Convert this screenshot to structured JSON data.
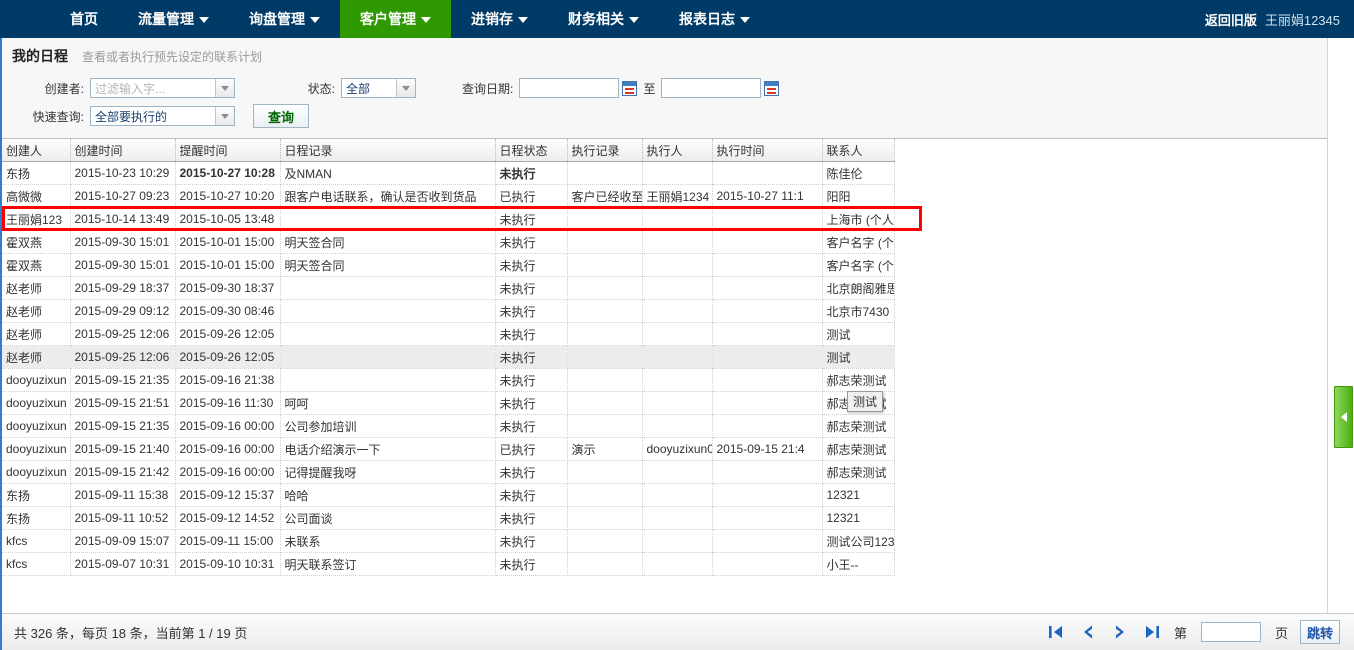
{
  "nav": {
    "items": [
      {
        "label": "首页",
        "has_caret": false,
        "active": false
      },
      {
        "label": "流量管理",
        "has_caret": true,
        "active": false
      },
      {
        "label": "询盘管理",
        "has_caret": true,
        "active": false
      },
      {
        "label": "客户管理",
        "has_caret": true,
        "active": true
      },
      {
        "label": "进销存",
        "has_caret": true,
        "active": false
      },
      {
        "label": "财务相关",
        "has_caret": true,
        "active": false
      },
      {
        "label": "报表日志",
        "has_caret": true,
        "active": false
      }
    ],
    "old_version": "返回旧版",
    "user": "王丽娟12345"
  },
  "header": {
    "title": "我的日程",
    "subtitle": "查看或者执行预先设定的联系计划"
  },
  "filters": {
    "creator_label": "创建者:",
    "creator_placeholder": "过滤输入字...",
    "creator_value": "",
    "status_label": "状态:",
    "status_value": "全部",
    "date_label": "查询日期:",
    "date_from": "",
    "date_to": "",
    "date_sep": "至",
    "quick_label": "快速查询:",
    "quick_value": "全部要执行的",
    "query_button": "查询"
  },
  "table": {
    "columns": [
      "创建人",
      "创建时间",
      "提醒时间",
      "日程记录",
      "日程状态",
      "执行记录",
      "执行人",
      "执行时间",
      "联系人"
    ],
    "rows": [
      {
        "creator": "东扬",
        "created": "2015-10-23 10:29",
        "remind": "2015-10-27 10:28",
        "note": "及NMAN",
        "status": "未执行",
        "exec_note": "",
        "exec_by": "",
        "exec_time": "",
        "contact": "陈佳伦",
        "remind_style": "blue-bold",
        "status_style": "blue-bold",
        "highlight": false,
        "alt": false
      },
      {
        "creator": "高微微",
        "created": "2015-10-27 09:23",
        "remind": "2015-10-27 10:20",
        "note": "跟客户电话联系，确认是否收到货品",
        "status": "已执行",
        "exec_note": "客户已经收至",
        "exec_by": "王丽娟1234",
        "exec_time": "2015-10-27 11:1",
        "contact": "阳阳",
        "remind_style": "green",
        "status_style": "green",
        "highlight": true,
        "alt": false
      },
      {
        "creator": "王丽娟123",
        "created": "2015-10-14 13:49",
        "remind": "2015-10-05 13:48",
        "note": "",
        "status": "未执行",
        "exec_note": "",
        "exec_by": "",
        "exec_time": "",
        "contact": "上海市 (个人",
        "remind_style": "red",
        "status_style": "red",
        "highlight": false,
        "alt": false
      },
      {
        "creator": "霍双燕",
        "created": "2015-09-30 15:01",
        "remind": "2015-10-01 15:00",
        "note": "明天签合同",
        "status": "未执行",
        "exec_note": "",
        "exec_by": "",
        "exec_time": "",
        "contact": "客户名字 (个",
        "remind_style": "red",
        "status_style": "red",
        "highlight": false,
        "alt": false
      },
      {
        "creator": "霍双燕",
        "created": "2015-09-30 15:01",
        "remind": "2015-10-01 15:00",
        "note": "明天签合同",
        "status": "未执行",
        "exec_note": "",
        "exec_by": "",
        "exec_time": "",
        "contact": "客户名字 (个",
        "remind_style": "red",
        "status_style": "red",
        "highlight": false,
        "alt": false
      },
      {
        "creator": "赵老师",
        "created": "2015-09-29 18:37",
        "remind": "2015-09-30 18:37",
        "note": "",
        "status": "未执行",
        "exec_note": "",
        "exec_by": "",
        "exec_time": "",
        "contact": "北京朗阁雅思",
        "remind_style": "red",
        "status_style": "red",
        "highlight": false,
        "alt": false
      },
      {
        "creator": "赵老师",
        "created": "2015-09-29 09:12",
        "remind": "2015-09-30 08:46",
        "note": "",
        "status": "未执行",
        "exec_note": "",
        "exec_by": "",
        "exec_time": "",
        "contact": "北京市7430",
        "remind_style": "red",
        "status_style": "red",
        "highlight": false,
        "alt": false
      },
      {
        "creator": "赵老师",
        "created": "2015-09-25 12:06",
        "remind": "2015-09-26 12:05",
        "note": "",
        "status": "未执行",
        "exec_note": "",
        "exec_by": "",
        "exec_time": "",
        "contact": "测试",
        "remind_style": "red",
        "status_style": "red",
        "highlight": false,
        "alt": false
      },
      {
        "creator": "赵老师",
        "created": "2015-09-25 12:06",
        "remind": "2015-09-26 12:05",
        "note": "",
        "status": "未执行",
        "exec_note": "",
        "exec_by": "",
        "exec_time": "",
        "contact": "测试",
        "remind_style": "red",
        "status_style": "red",
        "highlight": false,
        "alt": true
      },
      {
        "creator": "dooyuzixun",
        "created": "2015-09-15 21:35",
        "remind": "2015-09-16 21:38",
        "note": "",
        "status": "未执行",
        "exec_note": "",
        "exec_by": "",
        "exec_time": "",
        "contact": "郝志荣测试",
        "remind_style": "red",
        "status_style": "red",
        "highlight": false,
        "alt": false
      },
      {
        "creator": "dooyuzixun",
        "created": "2015-09-15 21:51",
        "remind": "2015-09-16 11:30",
        "note": "呵呵",
        "status": "未执行",
        "exec_note": "",
        "exec_by": "",
        "exec_time": "",
        "contact": "郝志荣测试",
        "remind_style": "red",
        "status_style": "red",
        "highlight": false,
        "alt": false
      },
      {
        "creator": "dooyuzixun",
        "created": "2015-09-15 21:35",
        "remind": "2015-09-16 00:00",
        "note": "公司参加培训",
        "status": "未执行",
        "exec_note": "",
        "exec_by": "",
        "exec_time": "",
        "contact": "郝志荣测试",
        "remind_style": "red",
        "status_style": "red",
        "highlight": false,
        "alt": false
      },
      {
        "creator": "dooyuzixun",
        "created": "2015-09-15 21:40",
        "remind": "2015-09-16 00:00",
        "note": "电话介绍演示一下",
        "status": "已执行",
        "exec_note": "演示",
        "exec_by": "dooyuzixun0",
        "exec_time": "2015-09-15 21:4",
        "contact": "郝志荣测试",
        "remind_style": "green",
        "status_style": "green",
        "highlight": false,
        "alt": false
      },
      {
        "creator": "dooyuzixun",
        "created": "2015-09-15 21:42",
        "remind": "2015-09-16 00:00",
        "note": "记得提醒我呀",
        "status": "未执行",
        "exec_note": "",
        "exec_by": "",
        "exec_time": "",
        "contact": "郝志荣测试",
        "remind_style": "red",
        "status_style": "red",
        "highlight": false,
        "alt": false
      },
      {
        "creator": "东扬",
        "created": "2015-09-11 15:38",
        "remind": "2015-09-12 15:37",
        "note": "哈哈",
        "status": "未执行",
        "exec_note": "",
        "exec_by": "",
        "exec_time": "",
        "contact": "12321",
        "remind_style": "red",
        "status_style": "red",
        "highlight": false,
        "alt": false
      },
      {
        "creator": "东扬",
        "created": "2015-09-11 10:52",
        "remind": "2015-09-12 14:52",
        "note": "公司面谈",
        "status": "未执行",
        "exec_note": "",
        "exec_by": "",
        "exec_time": "",
        "contact": "12321",
        "remind_style": "red",
        "status_style": "red",
        "highlight": false,
        "alt": false
      },
      {
        "creator": "kfcs",
        "created": "2015-09-09 15:07",
        "remind": "2015-09-11 15:00",
        "note": "未联系",
        "status": "未执行",
        "exec_note": "",
        "exec_by": "",
        "exec_time": "",
        "contact": "测试公司123",
        "remind_style": "red",
        "status_style": "red",
        "highlight": false,
        "alt": false
      },
      {
        "creator": "kfcs",
        "created": "2015-09-07 10:31",
        "remind": "2015-09-10 10:31",
        "note": "明天联系签订",
        "status": "未执行",
        "exec_note": "",
        "exec_by": "",
        "exec_time": "",
        "contact": "小王--",
        "remind_style": "red",
        "status_style": "red",
        "highlight": false,
        "alt": false
      }
    ]
  },
  "tooltip": {
    "text": "测试"
  },
  "footer": {
    "summary": "共 326 条，每页 18 条，当前第 1 / 19 页",
    "jump_prefix": "第",
    "jump_value": "",
    "jump_suffix": "页",
    "jump_button": "跳转",
    "first_label": "first-page",
    "prev_label": "prev-page",
    "next_label": "next-page",
    "last_label": "last-page"
  },
  "colors": {
    "nav_bg": "#003a66",
    "accent_green": "#2e9900",
    "highlight_red": "#ff0000",
    "link_blue": "#2a7fd4"
  }
}
